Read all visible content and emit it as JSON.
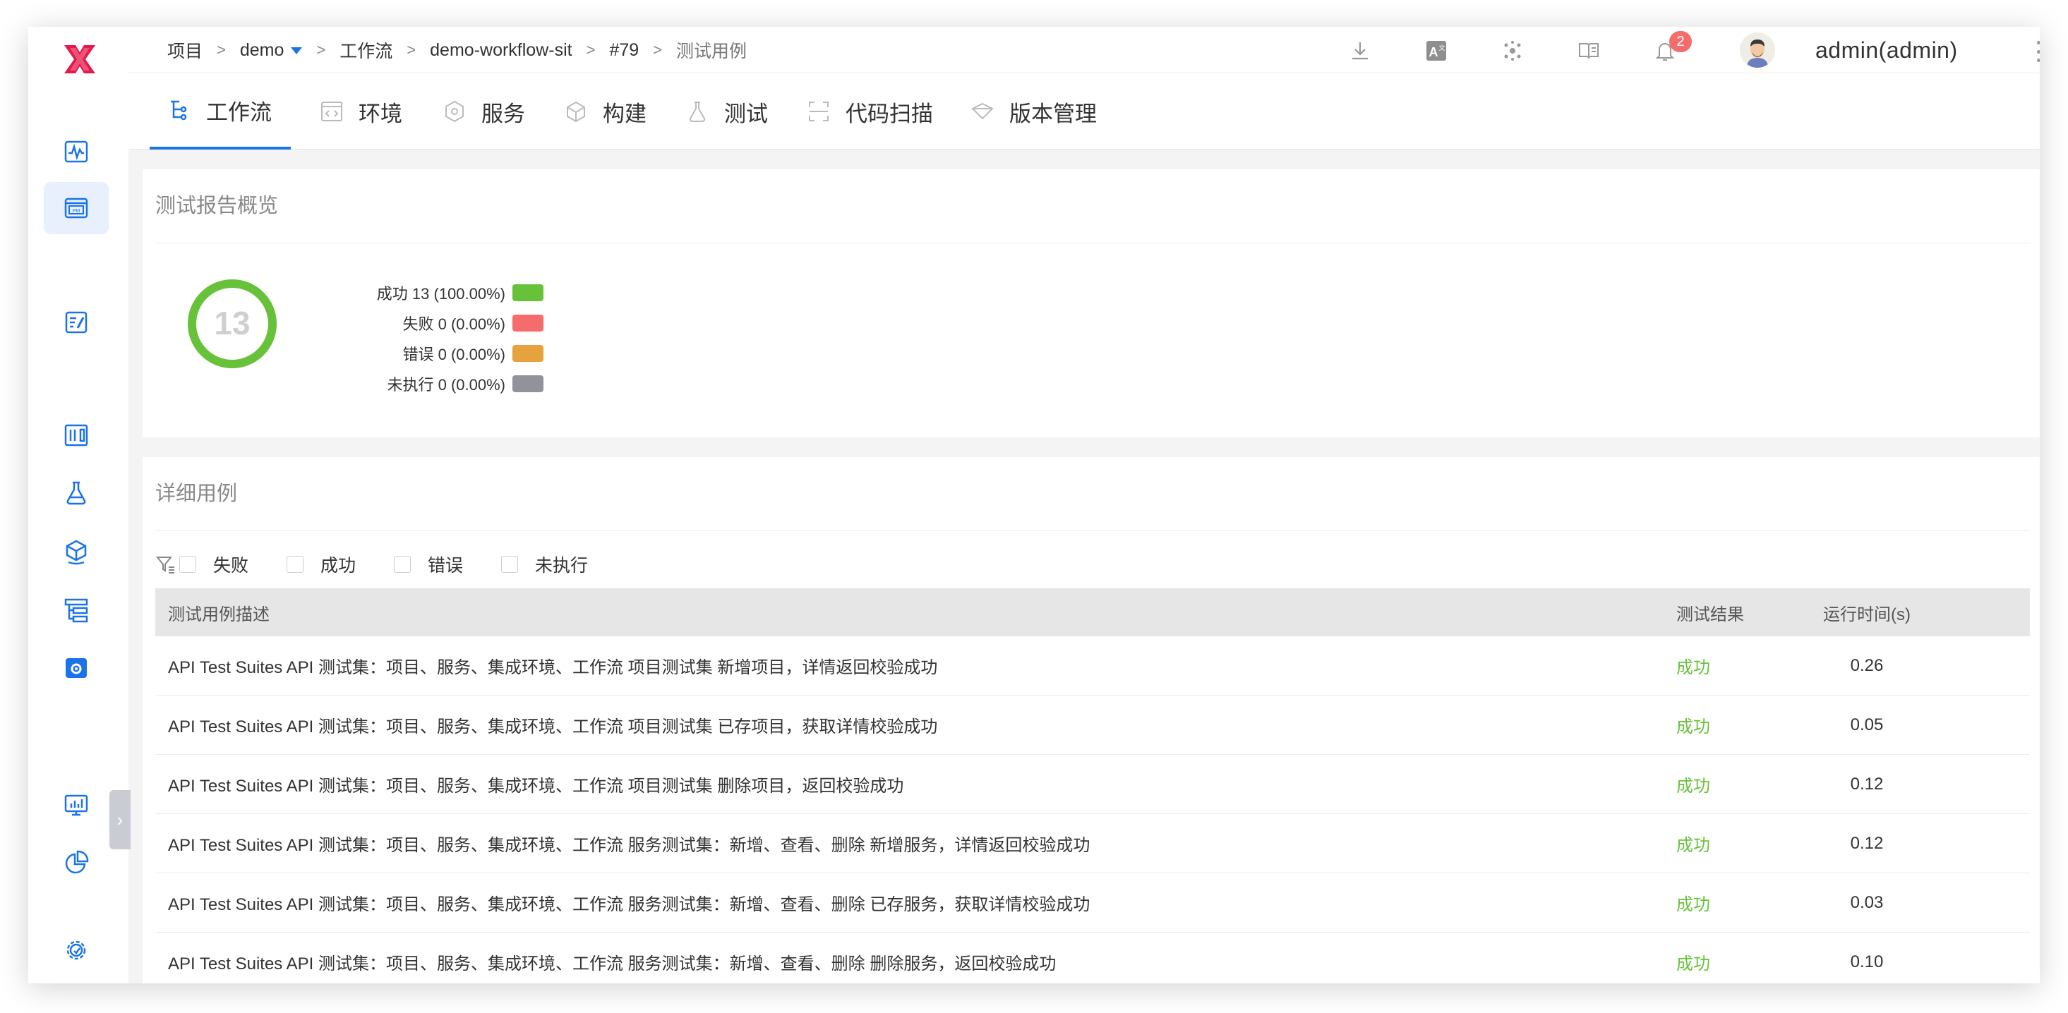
{
  "breadcrumb": {
    "items": [
      "项目",
      "demo",
      "工作流",
      "demo-workflow-sit",
      "#79",
      "测试用例"
    ],
    "separator": ">"
  },
  "header": {
    "notification_count": "2",
    "username": "admin(admin)"
  },
  "tabs": [
    {
      "label": "工作流",
      "icon": "workflow-icon",
      "active": true
    },
    {
      "label": "环境",
      "icon": "environment-icon",
      "active": false
    },
    {
      "label": "服务",
      "icon": "service-icon",
      "active": false
    },
    {
      "label": "构建",
      "icon": "build-icon",
      "active": false
    },
    {
      "label": "测试",
      "icon": "test-flask-icon",
      "active": false
    },
    {
      "label": "代码扫描",
      "icon": "code-scan-icon",
      "active": false
    },
    {
      "label": "版本管理",
      "icon": "version-icon",
      "active": false
    }
  ],
  "overview": {
    "title": "测试报告概览",
    "total": "13",
    "legend": [
      {
        "label": "成功 13 (100.00%)",
        "color": "#67c23a"
      },
      {
        "label": "失败 0 (0.00%)",
        "color": "#f56c6c"
      },
      {
        "label": "错误 0 (0.00%)",
        "color": "#e6a23c"
      },
      {
        "label": "未执行 0 (0.00%)",
        "color": "#909399"
      }
    ],
    "success_fraction": 1.0
  },
  "details": {
    "title": "详细用例",
    "filters": [
      "失败",
      "成功",
      "错误",
      "未执行"
    ],
    "columns": [
      "测试用例描述",
      "测试结果",
      "运行时间(s)"
    ],
    "rows": [
      {
        "desc": "API Test Suites API 测试集：项目、服务、集成环境、工作流 项目测试集 新增项目，详情返回校验成功",
        "result": "成功",
        "time": "0.26"
      },
      {
        "desc": "API Test Suites API 测试集：项目、服务、集成环境、工作流 项目测试集 已存项目，获取详情校验成功",
        "result": "成功",
        "time": "0.05"
      },
      {
        "desc": "API Test Suites API 测试集：项目、服务、集成环境、工作流 项目测试集 删除项目，返回校验成功",
        "result": "成功",
        "time": "0.12"
      },
      {
        "desc": "API Test Suites API 测试集：项目、服务、集成环境、工作流 服务测试集：新增、查看、删除 新增服务，详情返回校验成功",
        "result": "成功",
        "time": "0.12"
      },
      {
        "desc": "API Test Suites API 测试集：项目、服务、集成环境、工作流 服务测试集：新增、查看、删除 已存服务，获取详情校验成功",
        "result": "成功",
        "time": "0.03"
      },
      {
        "desc": "API Test Suites API 测试集：项目、服务、集成环境、工作流 服务测试集：新增、查看、删除 删除服务，返回校验成功",
        "result": "成功",
        "time": "0.10"
      }
    ]
  },
  "colors": {
    "accent": "#1a73e8",
    "brand": "#e6194b",
    "success": "#67c23a"
  }
}
